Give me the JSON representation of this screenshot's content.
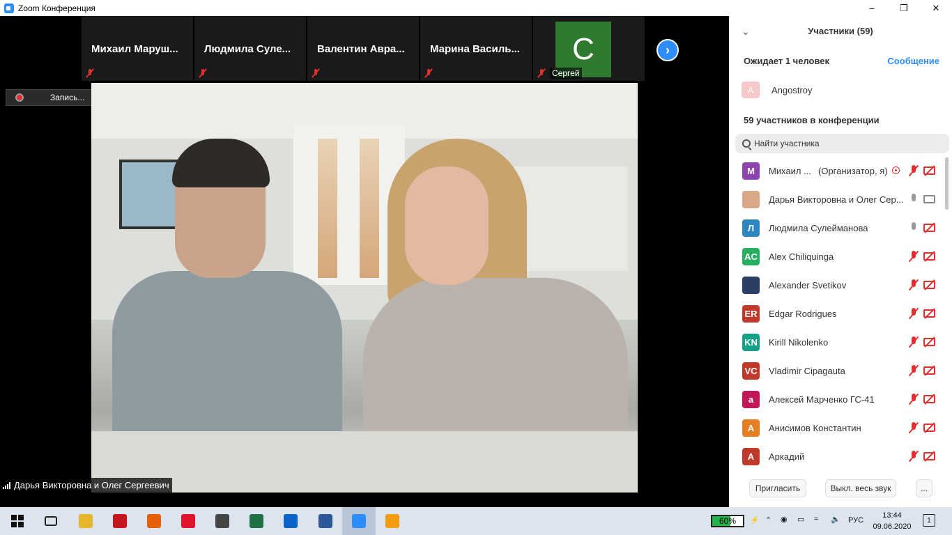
{
  "window": {
    "title": "Zoom Конференция"
  },
  "strip": {
    "tiles": [
      {
        "name": "Михаил  Маруш..."
      },
      {
        "name": "Людмила  Суле..."
      },
      {
        "name": "Валентин  Авра..."
      },
      {
        "name": "Марина  Василь..."
      }
    ],
    "avatar_tile": {
      "letter": "C",
      "name": "Сергей",
      "color": "#2f7a2f"
    }
  },
  "recording": {
    "label": "Запись..."
  },
  "active_speaker": {
    "label": "Дарья Викторовна и Олег Сергеевич"
  },
  "panel": {
    "title": "Участники (59)",
    "waiting_label": "Ожидает 1 человек",
    "message_button": "Сообщение",
    "waiting_person": {
      "initial": "A",
      "name": "Angostroy"
    },
    "count_label": "59 участников в конференции",
    "search_placeholder": "Найти участника",
    "participants": [
      {
        "initials": "М",
        "color": "#8e44ad",
        "name": "Михаил ...",
        "role": "(Организатор, я)",
        "mic": "off",
        "cam": "off"
      },
      {
        "initials": "",
        "color": "#d9a886",
        "name": "Дарья Викторовна и Олег Сер...",
        "role": "",
        "mic": "on",
        "cam": "on"
      },
      {
        "initials": "Л",
        "color": "#2e86c1",
        "name": "Людмила Сулейманова",
        "role": "",
        "mic": "on",
        "cam": "off"
      },
      {
        "initials": "AC",
        "color": "#27ae60",
        "name": "Alex Chiliquinga",
        "role": "",
        "mic": "off",
        "cam": "off"
      },
      {
        "initials": "",
        "color": "#2c3e63",
        "name": "Alexander Svetikov",
        "role": "",
        "mic": "off",
        "cam": "off"
      },
      {
        "initials": "ER",
        "color": "#c0392b",
        "name": "Edgar Rodrigues",
        "role": "",
        "mic": "off",
        "cam": "off"
      },
      {
        "initials": "KN",
        "color": "#16a085",
        "name": "Kirill Nikolenko",
        "role": "",
        "mic": "off",
        "cam": "off"
      },
      {
        "initials": "VC",
        "color": "#c0392b",
        "name": "Vladimir Cipagauta",
        "role": "",
        "mic": "off",
        "cam": "off"
      },
      {
        "initials": "a",
        "color": "#c2185b",
        "name": "Алексей Марченко ГС-41",
        "role": "",
        "mic": "off",
        "cam": "off"
      },
      {
        "initials": "А",
        "color": "#e67e22",
        "name": "Анисимов Константин",
        "role": "",
        "mic": "off",
        "cam": "off"
      },
      {
        "initials": "А",
        "color": "#c0392b",
        "name": "Аркадий",
        "role": "",
        "mic": "off",
        "cam": "off"
      }
    ],
    "invite_button": "Пригласить",
    "mute_all_button": "Выкл. весь звук",
    "more_button": "..."
  },
  "taskbar": {
    "apps": [
      {
        "icon": "task-view-icon"
      },
      {
        "icon": "file-explorer-icon",
        "color": "#e8b62a"
      },
      {
        "icon": "acrobat-icon",
        "color": "#c4161c"
      },
      {
        "icon": "firefox-icon",
        "color": "#e66000"
      },
      {
        "icon": "opera-icon",
        "color": "#e0142b"
      },
      {
        "icon": "calculator-icon",
        "color": "#444444"
      },
      {
        "icon": "excel-icon",
        "color": "#1e7145"
      },
      {
        "icon": "outlook-icon",
        "color": "#0a64c8"
      },
      {
        "icon": "word-icon",
        "color": "#2b579a"
      },
      {
        "icon": "zoom-icon",
        "color": "#2d8cff"
      },
      {
        "icon": "media-player-icon",
        "color": "#f39c12"
      }
    ],
    "battery_percent": "60%",
    "battery_level": 0.6,
    "language": "РУС",
    "time": "13:44",
    "date": "09.06.2020",
    "notifications": "1"
  }
}
